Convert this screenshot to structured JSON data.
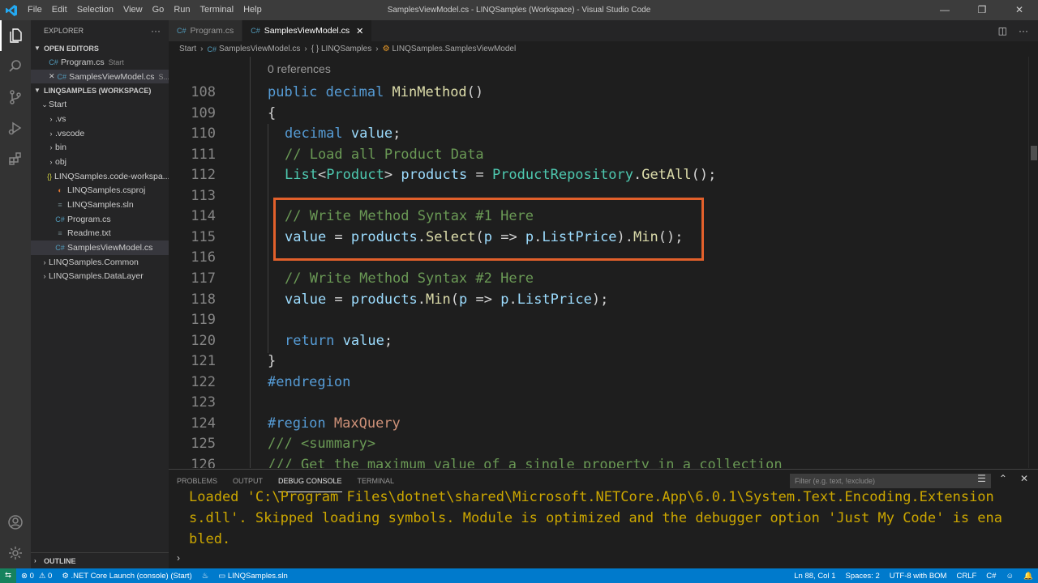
{
  "window": {
    "title": "SamplesViewModel.cs - LINQSamples (Workspace) - Visual Studio Code",
    "menu": [
      "File",
      "Edit",
      "Selection",
      "View",
      "Go",
      "Run",
      "Terminal",
      "Help"
    ],
    "controls": [
      "—",
      "❐",
      "✕"
    ]
  },
  "sidebar": {
    "header": "EXPLORER",
    "more": "···",
    "open_editors_label": "OPEN EDITORS",
    "open_editors": [
      {
        "name": "Program.cs",
        "desc": "Start"
      },
      {
        "name": "SamplesViewModel.cs",
        "desc": "S..."
      }
    ],
    "workspace_label": "LINQSAMPLES (WORKSPACE)",
    "tree": [
      {
        "name": "Start",
        "indent": 1,
        "kind": "folder-open"
      },
      {
        "name": ".vs",
        "indent": 2,
        "kind": "folder"
      },
      {
        "name": ".vscode",
        "indent": 2,
        "kind": "folder"
      },
      {
        "name": "bin",
        "indent": 2,
        "kind": "folder"
      },
      {
        "name": "obj",
        "indent": 2,
        "kind": "folder"
      },
      {
        "name": "LINQSamples.code-workspa...",
        "indent": 2,
        "kind": "json"
      },
      {
        "name": "LINQSamples.csproj",
        "indent": 2,
        "kind": "rss"
      },
      {
        "name": "LINQSamples.sln",
        "indent": 2,
        "kind": "file"
      },
      {
        "name": "Program.cs",
        "indent": 2,
        "kind": "cs"
      },
      {
        "name": "Readme.txt",
        "indent": 2,
        "kind": "file"
      },
      {
        "name": "SamplesViewModel.cs",
        "indent": 2,
        "kind": "cs",
        "selected": true
      },
      {
        "name": "LINQSamples.Common",
        "indent": 1,
        "kind": "folder"
      },
      {
        "name": "LINQSamples.DataLayer",
        "indent": 1,
        "kind": "folder"
      }
    ],
    "outline_label": "OUTLINE"
  },
  "tabs": [
    {
      "label": "Program.cs",
      "active": false
    },
    {
      "label": "SamplesViewModel.cs",
      "active": true,
      "close": "✕"
    }
  ],
  "breadcrumb": [
    "Start",
    "SamplesViewModel.cs",
    "{ } LINQSamples",
    "LINQSamples.SamplesViewModel"
  ],
  "editor": {
    "codelens": "0 references",
    "lines": [
      {
        "n": "108",
        "indent": 0,
        "tokens": [
          [
            "kw",
            "public "
          ],
          [
            "kw",
            "decimal "
          ],
          [
            "fn",
            "MinMethod"
          ],
          [
            "tx",
            "()"
          ]
        ]
      },
      {
        "n": "109",
        "indent": 0,
        "tokens": [
          [
            "tx",
            "{"
          ]
        ]
      },
      {
        "n": "110",
        "indent": 1,
        "tokens": [
          [
            "kw",
            "decimal "
          ],
          [
            "va",
            "value"
          ],
          [
            "tx",
            ";"
          ]
        ]
      },
      {
        "n": "111",
        "indent": 1,
        "tokens": [
          [
            "cm",
            "// Load all Product Data"
          ]
        ]
      },
      {
        "n": "112",
        "indent": 1,
        "tokens": [
          [
            "ty",
            "List"
          ],
          [
            "tx",
            "<"
          ],
          [
            "ty",
            "Product"
          ],
          [
            "tx",
            "> "
          ],
          [
            "va",
            "products"
          ],
          [
            "tx",
            " = "
          ],
          [
            "ty",
            "ProductRepository"
          ],
          [
            "tx",
            "."
          ],
          [
            "fn",
            "GetAll"
          ],
          [
            "tx",
            "();"
          ]
        ]
      },
      {
        "n": "113",
        "indent": 0,
        "tokens": []
      },
      {
        "n": "114",
        "indent": 1,
        "tokens": [
          [
            "cm",
            "// Write Method Syntax #1 Here"
          ]
        ]
      },
      {
        "n": "115",
        "indent": 1,
        "tokens": [
          [
            "va",
            "value"
          ],
          [
            "tx",
            " = "
          ],
          [
            "va",
            "products"
          ],
          [
            "tx",
            "."
          ],
          [
            "fn",
            "Select"
          ],
          [
            "tx",
            "("
          ],
          [
            "va",
            "p"
          ],
          [
            "tx",
            " => "
          ],
          [
            "va",
            "p"
          ],
          [
            "tx",
            "."
          ],
          [
            "va",
            "ListPrice"
          ],
          [
            "tx",
            ")."
          ],
          [
            "fn",
            "Min"
          ],
          [
            "tx",
            "();"
          ]
        ]
      },
      {
        "n": "116",
        "indent": 0,
        "tokens": []
      },
      {
        "n": "117",
        "indent": 1,
        "tokens": [
          [
            "cm",
            "// Write Method Syntax #2 Here"
          ]
        ]
      },
      {
        "n": "118",
        "indent": 1,
        "tokens": [
          [
            "va",
            "value"
          ],
          [
            "tx",
            " = "
          ],
          [
            "va",
            "products"
          ],
          [
            "tx",
            "."
          ],
          [
            "fn",
            "Min"
          ],
          [
            "tx",
            "("
          ],
          [
            "va",
            "p"
          ],
          [
            "tx",
            " => "
          ],
          [
            "va",
            "p"
          ],
          [
            "tx",
            "."
          ],
          [
            "va",
            "ListPrice"
          ],
          [
            "tx",
            ");"
          ]
        ]
      },
      {
        "n": "119",
        "indent": 0,
        "tokens": []
      },
      {
        "n": "120",
        "indent": 1,
        "tokens": [
          [
            "kw",
            "return "
          ],
          [
            "va",
            "value"
          ],
          [
            "tx",
            ";"
          ]
        ]
      },
      {
        "n": "121",
        "indent": 0,
        "tokens": [
          [
            "tx",
            "}"
          ]
        ]
      },
      {
        "n": "122",
        "indent": 0,
        "tokens": [
          [
            "kw",
            "#endregion"
          ]
        ]
      },
      {
        "n": "123",
        "indent": 0,
        "tokens": []
      },
      {
        "n": "124",
        "indent": 0,
        "tokens": [
          [
            "kw",
            "#region "
          ],
          [
            "rg",
            "MaxQuery"
          ]
        ]
      },
      {
        "n": "125",
        "indent": 0,
        "tokens": [
          [
            "cm",
            "/// "
          ],
          [
            "cm",
            "<summary>"
          ]
        ]
      },
      {
        "n": "126",
        "indent": 0,
        "tokens": [
          [
            "cm",
            "/// Get the maximum value of a single property in a collection"
          ]
        ]
      }
    ]
  },
  "panel": {
    "tabs": [
      "PROBLEMS",
      "OUTPUT",
      "DEBUG CONSOLE",
      "TERMINAL"
    ],
    "active_tab": "DEBUG CONSOLE",
    "filter_placeholder": "Filter (e.g. text, !exclude)",
    "output": [
      "Loaded 'C:\\Program Files\\dotnet\\shared\\Microsoft.NETCore.App\\6.0.1\\System.Text.Encoding.Extension",
      "s.dll'. Skipped loading symbols. Module is optimized and the debugger option 'Just My Code' is ena",
      "bled."
    ],
    "prompt": "›"
  },
  "status": {
    "errors": "⊗ 0",
    "warnings": "⚠ 0",
    "launch": ".NET Core Launch (console) (Start)",
    "solution": "LINQSamples.sln",
    "position": "Ln 88, Col 1",
    "spaces": "Spaces: 2",
    "encoding": "UTF-8 with BOM",
    "eol": "CRLF",
    "language": "C#"
  },
  "colors": {
    "accent": "#007acc",
    "highlight_box": "#e2602b",
    "debug_output": "#cca700"
  }
}
